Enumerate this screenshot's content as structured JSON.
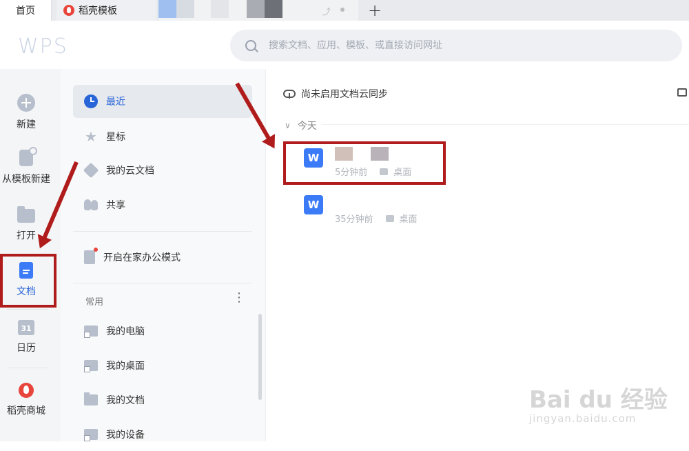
{
  "tabs": {
    "home": "首页",
    "template": "稻壳模板"
  },
  "header": {
    "logo": "WPS",
    "search_placeholder": "搜索文档、应用、模板、或直接访问网址"
  },
  "rail": {
    "items": [
      {
        "label": "新建",
        "icon": "plus-circle-icon"
      },
      {
        "label": "从模板新建",
        "icon": "template-icon"
      },
      {
        "label": "打开",
        "icon": "folder-icon"
      },
      {
        "label": "文档",
        "icon": "document-icon"
      },
      {
        "label": "日历",
        "icon": "calendar-icon",
        "glyph": "31"
      },
      {
        "label": "稻壳商城",
        "icon": "docer-shop-icon"
      }
    ]
  },
  "nav": {
    "items": [
      {
        "label": "最近",
        "icon": "clock-icon"
      },
      {
        "label": "星标",
        "icon": "star-icon"
      },
      {
        "label": "我的云文档",
        "icon": "cube-icon"
      },
      {
        "label": "共享",
        "icon": "share-users-icon"
      },
      {
        "label": "开启在家办公模式",
        "icon": "home-office-icon"
      }
    ],
    "section_title": "常用",
    "common": [
      {
        "label": "我的电脑",
        "icon": "computer-icon"
      },
      {
        "label": "我的桌面",
        "icon": "desktop-icon"
      },
      {
        "label": "我的文档",
        "icon": "folder-icon"
      },
      {
        "label": "我的设备",
        "icon": "device-icon"
      }
    ]
  },
  "main": {
    "sync_status": "尚未启用文档云同步",
    "group_today": "今天",
    "files": [
      {
        "time": "5分钟前",
        "location": "桌面"
      },
      {
        "time": "35分钟前",
        "location": "桌面"
      }
    ]
  },
  "watermark": {
    "line1": "Bai du 经验",
    "line2": "jingyan.baidu.com"
  },
  "colors": {
    "accent": "#2a65d8",
    "highlight": "#b01c1c",
    "word_icon": "#3b7bf7"
  }
}
